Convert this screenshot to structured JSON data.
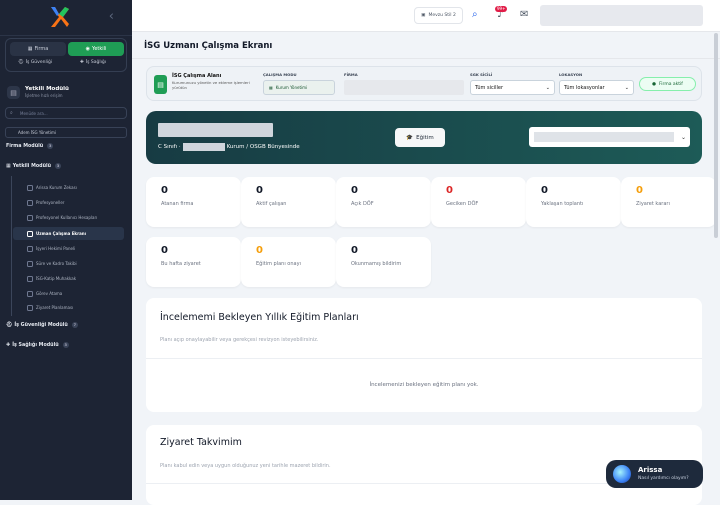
{
  "sidebar": {
    "panel_tabs": {
      "firma": "Firma",
      "yetkili": "Yetkili"
    },
    "links": {
      "is_guvenligi": "İş Güvenliği",
      "is_sagligi": "İş Sağlığı"
    },
    "module": {
      "title": "Yetkili Modülü",
      "subtitle": "İşletme hızlı erişim"
    },
    "search_placeholder": "Menüde ara...",
    "dropdown": "Adem İSG Yönetimi",
    "sections": {
      "firma_modulu": "Firma Modülü",
      "firma_badge": "3",
      "yetkili_modulu": "Yetkili Modülü",
      "yetkili_badge": "3",
      "is_guvenligi_modulu": "İş Güvenliği Modülü",
      "is_guvenligi_badge": "7",
      "is_sagligi_modulu": "İş Sağlığı Modülü",
      "is_sagligi_badge": "3"
    },
    "items": [
      "Arissa Kurum Zekası",
      "Profesyoneller",
      "Profesyonel Kullanıcı Hesapları",
      "Uzman Çalışma Ekranı",
      "İşyeri Hekimi Paneli",
      "Süre ve Kadro Takibi",
      "İSG-Katip Muhakkak",
      "Görev Atama",
      "Ziyaret Planlaması"
    ]
  },
  "topbar": {
    "mevzu_label": "Mevzu Stil 2",
    "notif_badge": "99+"
  },
  "page": {
    "title": "İSG Uzmanı Çalışma Ekranı"
  },
  "filter": {
    "title": "İSG Çalışma Alanı",
    "desc": "Kurumunuzu yönetin ve ekleme işlemleri yürütün",
    "mode_label": "ÇALIŞMA MODU",
    "mode_value": "Kurum Yönetimi",
    "firma_label": "FİRMA",
    "sgk_label": "SGK SİCİLİ",
    "sgk_value": "Tüm siciller",
    "lokasyon_label": "LOKASYON",
    "lokasyon_value": "Tüm lokasyonlar",
    "active_label": "Firma aktif"
  },
  "banner": {
    "info_prefix": "C Sınıfı ·",
    "info_suffix": "Kurum / OSGB Bünyesinde",
    "egitim_label": "Eğitim"
  },
  "stats": [
    {
      "value": "0",
      "label": "Atanan firma",
      "tone": "dark"
    },
    {
      "value": "0",
      "label": "Aktif çalışan",
      "tone": "dark"
    },
    {
      "value": "0",
      "label": "Açık DÖF",
      "tone": "dark"
    },
    {
      "value": "0",
      "label": "Geciken DÖF",
      "tone": "red"
    },
    {
      "value": "0",
      "label": "Yaklaşan toplantı",
      "tone": "dark"
    },
    {
      "value": "0",
      "label": "Ziyaret kararı",
      "tone": "yel"
    },
    {
      "value": "0",
      "label": "Bu hafta ziyaret",
      "tone": "dark"
    },
    {
      "value": "0",
      "label": "Eğitim planı onayı",
      "tone": "yel"
    },
    {
      "value": "0",
      "label": "Okunmamış bildirim",
      "tone": "dark"
    }
  ],
  "panel_training": {
    "title": "İncelememi Bekleyen Yıllık Eğitim Planları",
    "subtitle": "Planı açıp onaylayabilir veya gerekçesi revizyon isteyebilirsiniz.",
    "empty": "İncelemenizi bekleyen eğitim planı yok."
  },
  "panel_visit": {
    "title": "Ziyaret Takvimim",
    "subtitle": "Planı kabul edin veya uygun olduğunuz yeni tarihle mazeret bildirin."
  },
  "chat": {
    "title": "Arissa",
    "subtitle": "Nasıl yardımcı olayım?"
  },
  "colors": {
    "accent": "#1f9d55",
    "sidebar": "#1d2434",
    "banner": "#1d5b57"
  }
}
